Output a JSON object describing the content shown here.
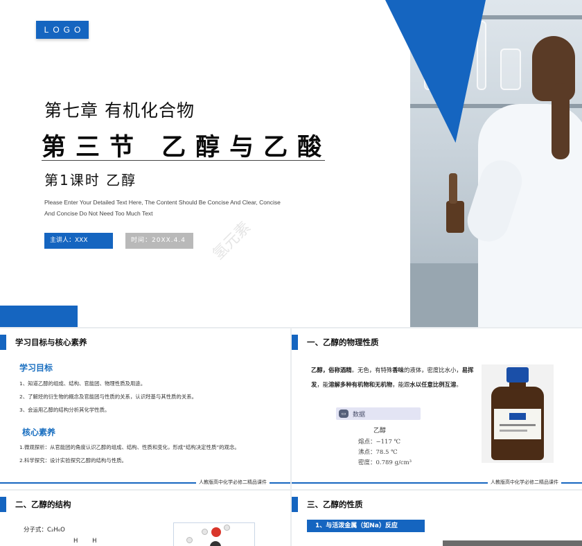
{
  "hero": {
    "logo": "LOGO",
    "chapter": "第七章 有机化合物",
    "section": "第三节  乙醇与乙酸",
    "lesson": "第1课时    乙醇",
    "desc_line1": "Please Enter Your Detailed Text Here, The Content Should Be Concise And Clear, Concise",
    "desc_line2": "And Concise Do Not Need Too Much Text",
    "speaker": "主讲人：XXX",
    "time": "时间：20XX.4.4",
    "watermark": "氢元素"
  },
  "slide1": {
    "heading": "学习目标与核心素养",
    "goals_title": "学习目标",
    "goals": [
      "1、知道乙醇的组成、结构、官能团、物理性质及用途。",
      "2、了解烃的衍生物的概念及官能团与性质的关系，认识羟基与其性质的关系。",
      "3、会运用乙醇的结构分析其化学性质。"
    ],
    "core_title": "核心素养",
    "core": [
      "1.微观探析：从官能团的角度认识乙醇的组成、结构、性质和变化，形成“结构决定性质”的观念。",
      "2.科学探究：设计实验探究乙醇的结构与性质。"
    ],
    "footer": "人教版高中化学必修二精品课件"
  },
  "slide2": {
    "heading": "一、乙醇的物理性质",
    "text_bold1": "乙醇，俗称酒精",
    "text_1": "。无色，有特殊",
    "text_bold2": "香味",
    "text_2": "的液体，密度比水小，",
    "text_bold3": "易挥发",
    "text_3": "，能",
    "text_bold4": "溶解多种有机物和无机物",
    "text_4": "，能跟",
    "text_bold5": "水以任意比例互溶",
    "text_5": "。",
    "data_label": "数据",
    "props_title": "乙醇",
    "props": [
      "熔点：−117 ℃",
      "沸点：78.5 ℃",
      "密度：0.789 g/cm³"
    ],
    "footer": "人教版高中化学必修二精品课件"
  },
  "slide3": {
    "heading": "二、乙醇的结构",
    "formula": "分子式：C₂H₆O",
    "h_row": "H H"
  },
  "slide4": {
    "heading": "三、乙醇的性质",
    "sub_label": "1、与活泼金属（如Na）反应"
  },
  "colors": {
    "accent": "#1565c0",
    "gray_pill": "#b9b9b9",
    "subtitle_blue": "#1a6fc0"
  }
}
